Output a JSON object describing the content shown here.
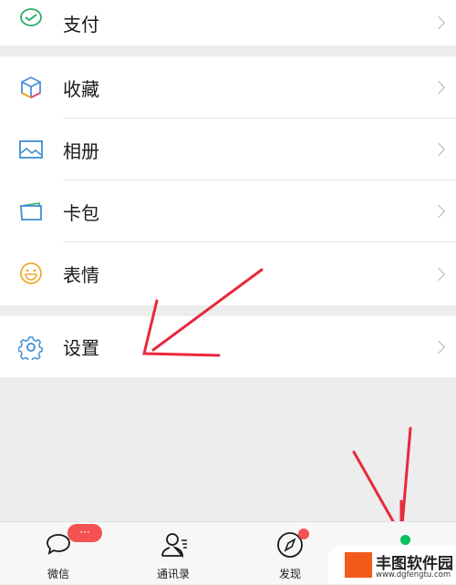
{
  "menu": [
    {
      "label": "支付",
      "icon": "wechat-pay-icon"
    },
    {
      "label": "收藏",
      "icon": "favorites-cube-icon"
    },
    {
      "label": "相册",
      "icon": "album-icon"
    },
    {
      "label": "卡包",
      "icon": "card-wallet-icon"
    },
    {
      "label": "表情",
      "icon": "sticker-smile-icon"
    },
    {
      "label": "设置",
      "icon": "settings-gear-icon"
    }
  ],
  "tabs": [
    {
      "label": "微信",
      "badge": "···"
    },
    {
      "label": "通讯录"
    },
    {
      "label": "发现"
    }
  ],
  "watermark": {
    "brand": "丰图软件园",
    "url": "www.dgfengtu.com"
  },
  "colors": {
    "accent": "#07c160",
    "badge": "#f45252",
    "annotation": "#e8283c"
  }
}
